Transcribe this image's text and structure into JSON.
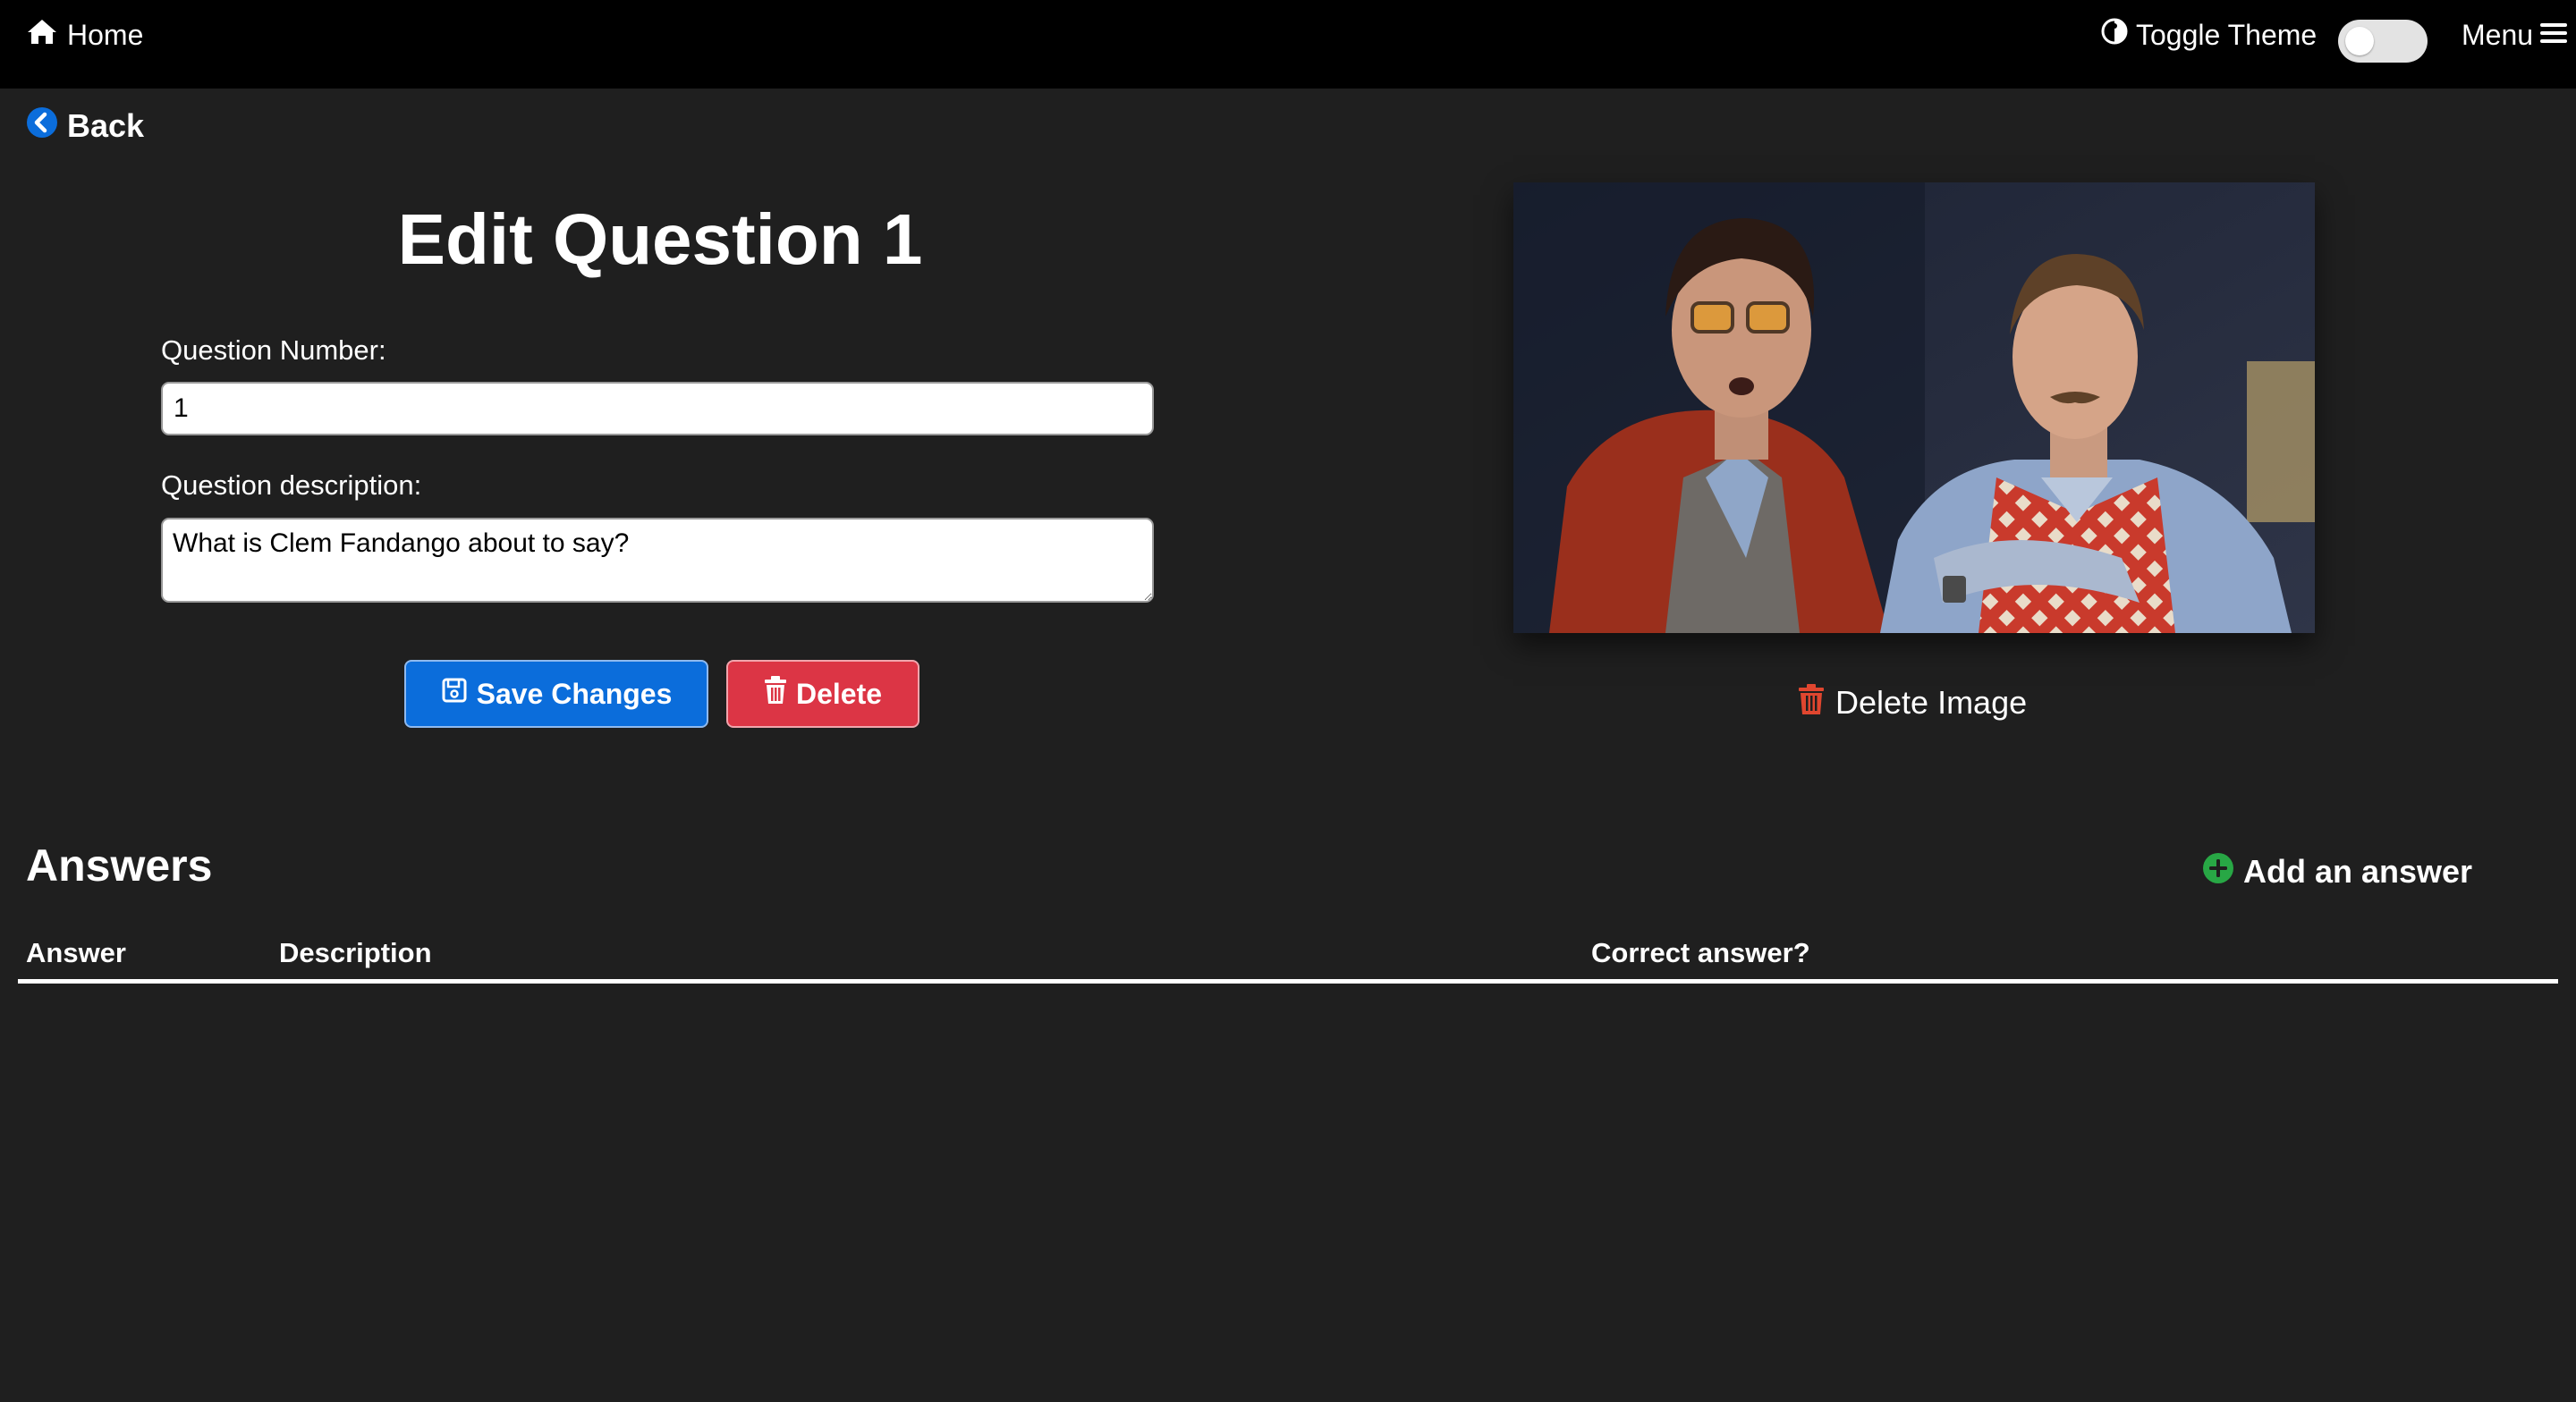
{
  "navbar": {
    "home_label": "Home",
    "toggle_theme_label": "Toggle Theme",
    "theme_toggle_on": false,
    "menu_label": "Menu"
  },
  "back": {
    "label": "Back"
  },
  "form": {
    "title": "Edit Question 1",
    "question_number_label": "Question Number:",
    "question_number_value": "1",
    "question_description_label": "Question description:",
    "question_description_value": "What is Clem Fandango about to say?",
    "save_label": "Save Changes",
    "delete_label": "Delete"
  },
  "image_panel": {
    "delete_image_label": "Delete Image"
  },
  "answers": {
    "heading": "Answers",
    "add_label": "Add an answer",
    "columns": [
      "Answer",
      "Description",
      "Correct answer?"
    ],
    "rows": []
  },
  "colors": {
    "page_background": "#1f1f1f",
    "navbar_background": "#000000",
    "primary_button": "#0b6ddb",
    "danger_button": "#dc3545",
    "back_icon": "#0b6ddb",
    "delete_image_icon": "#e0462f",
    "add_answer_icon": "#28a745"
  },
  "icons": {
    "home": "home-icon",
    "toggle_theme": "half-circle-icon",
    "menu": "hamburger-icon",
    "back": "chevron-left-circle-icon",
    "save": "floppy-disk-icon",
    "delete": "trash-icon",
    "delete_image": "trash-icon",
    "add_answer": "plus-circle-icon"
  }
}
